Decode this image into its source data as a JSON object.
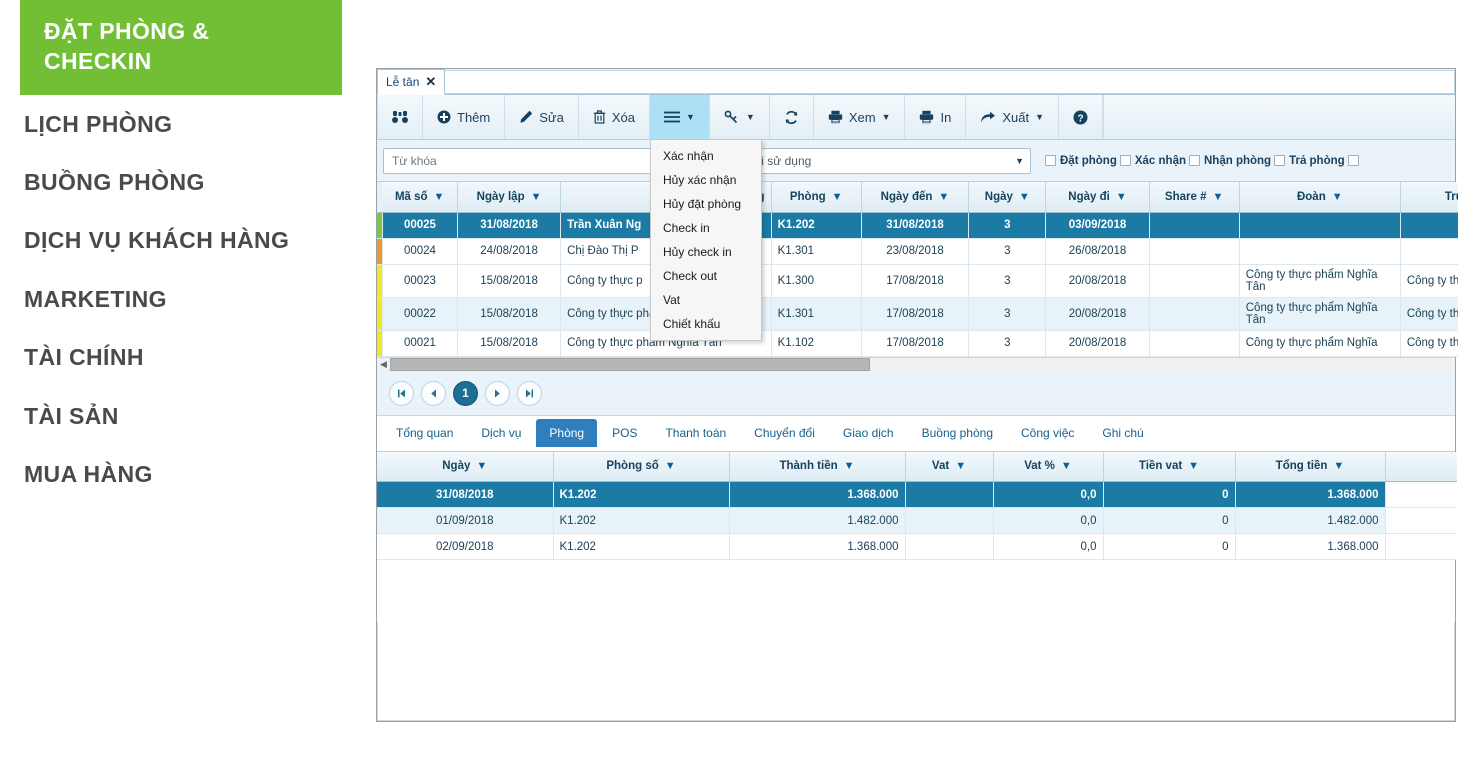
{
  "sidebar": {
    "items": [
      {
        "label": "ĐẶT PHÒNG & CHECKIN",
        "active": true
      },
      {
        "label": "LỊCH PHÒNG",
        "active": false
      },
      {
        "label": "BUỒNG PHÒNG",
        "active": false
      },
      {
        "label": "DỊCH VỤ KHÁCH HÀNG",
        "active": false
      },
      {
        "label": "MARKETING",
        "active": false
      },
      {
        "label": "TÀI CHÍNH",
        "active": false
      },
      {
        "label": "TÀI SẢN",
        "active": false
      },
      {
        "label": "MUA HÀNG",
        "active": false
      }
    ],
    "active_bg": "#72bf35"
  },
  "doc_tab": {
    "label": "Lễ tân",
    "close": "✕"
  },
  "toolbar": {
    "buttons": [
      {
        "icon": "binoculars-icon",
        "glyph": "∴",
        "label": ""
      },
      {
        "icon": "plus-circle-icon",
        "glyph": "⊕",
        "label": "Thêm"
      },
      {
        "icon": "pencil-icon",
        "glyph": "✎",
        "label": "Sửa"
      },
      {
        "icon": "trash-icon",
        "glyph": "Ὕ1",
        "label": "Xóa"
      },
      {
        "icon": "hamburger-menu-icon",
        "glyph": "☰",
        "label": "",
        "caret": "▼",
        "active": true
      },
      {
        "icon": "link-icon",
        "glyph": "ὑ7",
        "label": "",
        "caret": "▼"
      },
      {
        "icon": "refresh-icon",
        "glyph": "↻",
        "label": ""
      },
      {
        "icon": "printer-icon",
        "glyph": "⎙",
        "label": "Xem",
        "caret": "▼"
      },
      {
        "icon": "printer-icon",
        "glyph": "⎙",
        "label": "In"
      },
      {
        "icon": "export-arrow-icon",
        "glyph": "➦",
        "label": "Xuất",
        "caret": "▼"
      },
      {
        "icon": "help-icon",
        "glyph": "?",
        "label": ""
      }
    ]
  },
  "dropdown_menu": {
    "items": [
      "Xác nhận",
      "Hủy xác nhận",
      "Hủy đặt phòng",
      "Check in",
      "Hủy check in",
      "Check out",
      "Vat",
      "Chiết khấu"
    ]
  },
  "filters": {
    "keyword_placeholder": "Từ khóa",
    "keyword_value": "",
    "user_placeholder": "Người sử dụng",
    "user_value": "",
    "checkboxes": [
      {
        "label": "Đặt phòng",
        "checked": false
      },
      {
        "label": "Xác nhận",
        "checked": false
      },
      {
        "label": "Nhận phòng",
        "checked": false
      },
      {
        "label": "Trả phòng",
        "checked": false
      },
      {
        "label": "",
        "checked": false
      }
    ]
  },
  "top_grid": {
    "columns": [
      "Mã số",
      "Ngày lập",
      "Đối tượng",
      "Phòng",
      "Ngày đến",
      "Ngày",
      "Ngày đi",
      "Share #",
      "Đoàn",
      "Trưởng đoàn"
    ],
    "rows": [
      {
        "state": "selected",
        "mark": "#7ac943",
        "cells": [
          "00025",
          "31/08/2018",
          "Trần Xuân Ng",
          "K1.202",
          "31/08/2018",
          "3",
          "03/09/2018",
          "",
          "",
          ""
        ]
      },
      {
        "state": "plain",
        "mark": "#f0972a",
        "cells": [
          "00024",
          "24/08/2018",
          "Chị Đào Thị P",
          "K1.301",
          "23/08/2018",
          "3",
          "26/08/2018",
          "",
          "",
          ""
        ]
      },
      {
        "state": "plain",
        "mark": "#f2ea1c",
        "cells": [
          "00023",
          "15/08/2018",
          "Công ty thực p",
          "K1.300",
          "17/08/2018",
          "3",
          "20/08/2018",
          "",
          "Công ty thực phẩm Nghĩa Tân",
          "Công ty thực phẩ Tân"
        ]
      },
      {
        "state": "alt",
        "mark": "#f2ea1c",
        "cells": [
          "00022",
          "15/08/2018",
          "Công ty thực phẩm Nghĩa Tân",
          "K1.301",
          "17/08/2018",
          "3",
          "20/08/2018",
          "",
          "Công ty thực phẩm Nghĩa Tân",
          "Công ty thực phẩ Tân"
        ]
      },
      {
        "state": "plain",
        "mark": "#f2ea1c",
        "cells": [
          "00021",
          "15/08/2018",
          "Công ty thực phẩm Nghĩa Tân",
          "K1.102",
          "17/08/2018",
          "3",
          "20/08/2018",
          "",
          "Công ty thực phẩm Nghĩa",
          "Công ty thực phẩ"
        ]
      }
    ]
  },
  "pager": {
    "first": "⏮",
    "prev": "◀",
    "current": "1",
    "next": "▶",
    "last": "⏭"
  },
  "bottom_tabs": [
    {
      "label": "Tổng quan",
      "active": false
    },
    {
      "label": "Dịch vụ",
      "active": false
    },
    {
      "label": "Phòng",
      "active": true
    },
    {
      "label": "POS",
      "active": false
    },
    {
      "label": "Thanh toán",
      "active": false
    },
    {
      "label": "Chuyển đổi",
      "active": false
    },
    {
      "label": "Giao dịch",
      "active": false
    },
    {
      "label": "Buồng phòng",
      "active": false
    },
    {
      "label": "Công việc",
      "active": false
    },
    {
      "label": "Ghi chú",
      "active": false
    }
  ],
  "bottom_grid": {
    "columns": [
      "Ngày",
      "Phòng số",
      "Thành tiền",
      "Vat",
      "Vat %",
      "Tiền vat",
      "Tổng tiền"
    ],
    "rows": [
      {
        "state": "selected",
        "cells": [
          "31/08/2018",
          "K1.202",
          "1.368.000",
          "",
          "0,0",
          "0",
          "1.368.000"
        ]
      },
      {
        "state": "alt",
        "cells": [
          "01/09/2018",
          "K1.202",
          "1.482.000",
          "",
          "0,0",
          "0",
          "1.482.000"
        ]
      },
      {
        "state": "plain",
        "cells": [
          "02/09/2018",
          "K1.202",
          "1.368.000",
          "",
          "0,0",
          "0",
          "1.368.000"
        ]
      }
    ]
  },
  "colors": {
    "accent_green": "#72bf35",
    "selected_row": "#1b7ba4",
    "tab_active": "#2f7fbf",
    "header_text": "#14435f"
  }
}
